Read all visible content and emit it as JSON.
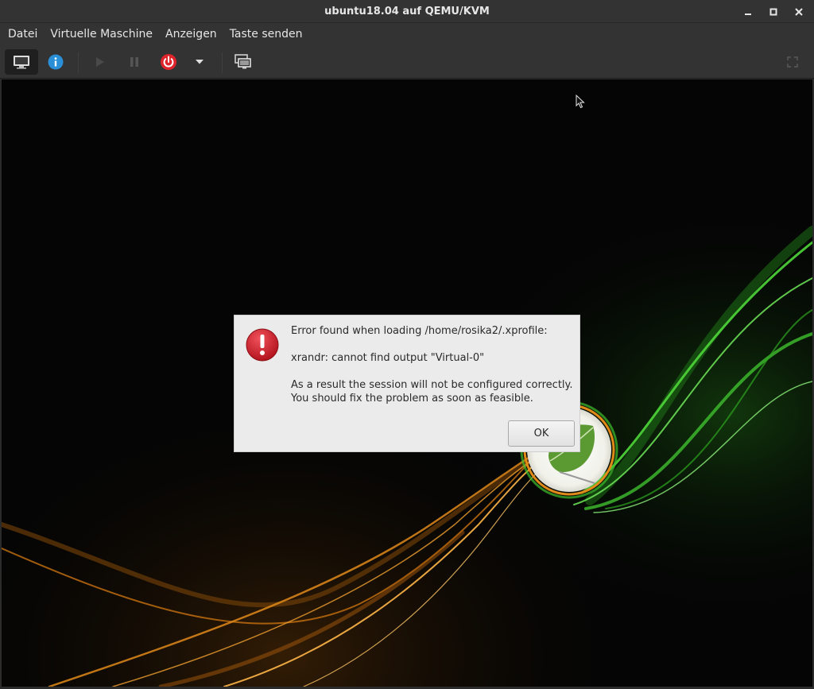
{
  "window": {
    "title": "ubuntu18.04 auf QEMU/KVM",
    "controls": [
      "minimize-icon",
      "maximize-icon",
      "close-icon"
    ]
  },
  "menubar": {
    "items": [
      "Datei",
      "Virtuelle Maschine",
      "Anzeigen",
      "Taste senden"
    ]
  },
  "toolbar": {
    "buttons": [
      {
        "name": "console-view-button",
        "icon": "monitor-icon",
        "active": true
      },
      {
        "name": "details-view-button",
        "icon": "info-icon",
        "color": "#2a8fd6"
      },
      {
        "name": "run-button",
        "icon": "play-icon",
        "enabled": false
      },
      {
        "name": "pause-button",
        "icon": "pause-icon",
        "enabled": false
      },
      {
        "name": "shutdown-button",
        "icon": "power-icon",
        "color": "#e0242b"
      },
      {
        "name": "shutdown-menu-button",
        "icon": "chevron-down-icon"
      },
      {
        "name": "snapshots-button",
        "icon": "screens-icon"
      },
      {
        "name": "fullscreen-button",
        "icon": "fullscreen-icon",
        "enabled": false
      }
    ]
  },
  "dialog": {
    "icon": "error-icon",
    "line1": "Error found when loading /home/rosika2/.xprofile:",
    "line2": "xrandr: cannot find output \"Virtual-0\"",
    "line3": "As a result the session will not be configured correctly.",
    "line4": "You should fix the problem as soon as feasible.",
    "ok_label": "OK"
  },
  "colors": {
    "titlebar": "#333333",
    "desktop": "#050505",
    "dialog_bg": "#ebebeb",
    "error_red": "#c8202a",
    "wave_green": "#4fd63a",
    "wave_orange": "#e08a1a"
  }
}
